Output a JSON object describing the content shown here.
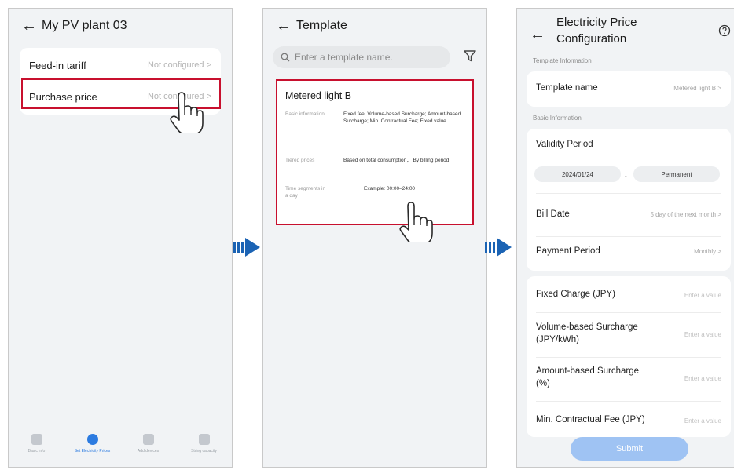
{
  "screen1": {
    "title": "My PV plant 03",
    "rows": [
      {
        "label": "Feed-in tariff",
        "value": "Not configured"
      },
      {
        "label": "Purchase price",
        "value": "Not configured"
      }
    ],
    "tabs": [
      "Basic info",
      "Set Electricity Prices",
      "Add devices",
      "String capacity"
    ]
  },
  "screen2": {
    "title": "Template",
    "search_placeholder": "Enter a template name.",
    "template": {
      "name": "Metered light B",
      "basic_key": "Basic information",
      "basic_value": "Fixed fee; Volume-based Surcharge; Amount-based Surcharge; Min. Contractual Fee; Fixed value",
      "tiered_key": "Tiered prices",
      "tiered_value": "Based on total consumption， By billing period",
      "time_key": "Time segments in a day",
      "time_value": "Example:  00:00–24:00"
    }
  },
  "screen3": {
    "title": "Electricity Price Configuration",
    "section_template": "Template Information",
    "template_name_label": "Template name",
    "template_name_value": "Metered light B",
    "section_basic": "Basic Information",
    "validity_label": "Validity Period",
    "validity_start": "2024/01/24",
    "validity_end": "Permanent",
    "bill_date_label": "Bill Date",
    "bill_date_value": "5 day of the next month",
    "payment_label": "Payment Period",
    "payment_value": "Monthly",
    "fixed_charge_label": "Fixed Charge (JPY)",
    "volume_label": "Volume-based Surcharge (JPY/kWh)",
    "amount_label": "Amount-based Surcharge (%)",
    "min_fee_label": "Min. Contractual Fee (JPY)",
    "input_placeholder": "Enter a value",
    "submit_label": "Submit"
  },
  "colors": {
    "highlight": "#c8102e",
    "arrow": "#1b63b4",
    "accent": "#2c7be0",
    "submit": "#9fc3f3"
  }
}
